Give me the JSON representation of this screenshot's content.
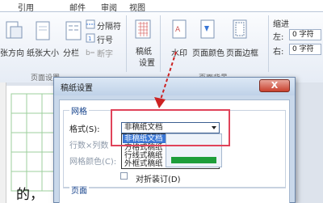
{
  "ribbon": {
    "tabs": [
      "引用",
      "邮件",
      "审阅",
      "视图"
    ],
    "page_setup": {
      "margins": "张方向",
      "size": "纸张大小",
      "columns": "分栏",
      "breaks": "分隔符",
      "line_numbers": "行号",
      "hyphenation": "断字",
      "group_label": "页面设置"
    },
    "draft_paper": {
      "label_line1": "稿纸",
      "label_line2": "设置"
    },
    "page_background": {
      "watermark": "水印",
      "page_color": "页面颜色",
      "page_borders": "页面边框",
      "group_label": "页面背景"
    },
    "indent": {
      "title": "缩进",
      "left_label": "左:",
      "left_value": "0 字符",
      "right_label": "右:",
      "right_value": "0 字符"
    }
  },
  "document": {
    "visible_text": "的，"
  },
  "dialog": {
    "title": "稿纸设置",
    "close": "X",
    "section_grid": "网格",
    "format_label": "格式(S):",
    "format_value": "非稿纸文档",
    "dropdown_options": [
      "非稿纸文档",
      "方格式稿纸",
      "行线式稿纸",
      "外框式稿纸"
    ],
    "selected_option_index": 0,
    "rows_cols_label": "行数×列数",
    "grid_color_label": "网格颜色(C):",
    "fold_gutter_label": "对折装订(D)",
    "section_page": "页面"
  },
  "colors": {
    "highlight_border": "#e0435a",
    "annotation_arrow": "#cc2222",
    "selection": "#3a77d6"
  },
  "icons": [
    "orientation-icon",
    "paper-size-icon",
    "columns-icon",
    "breaks-icon",
    "line-numbers-icon",
    "hyphenation-icon",
    "draft-paper-icon",
    "watermark-icon",
    "page-color-icon",
    "page-borders-icon"
  ]
}
